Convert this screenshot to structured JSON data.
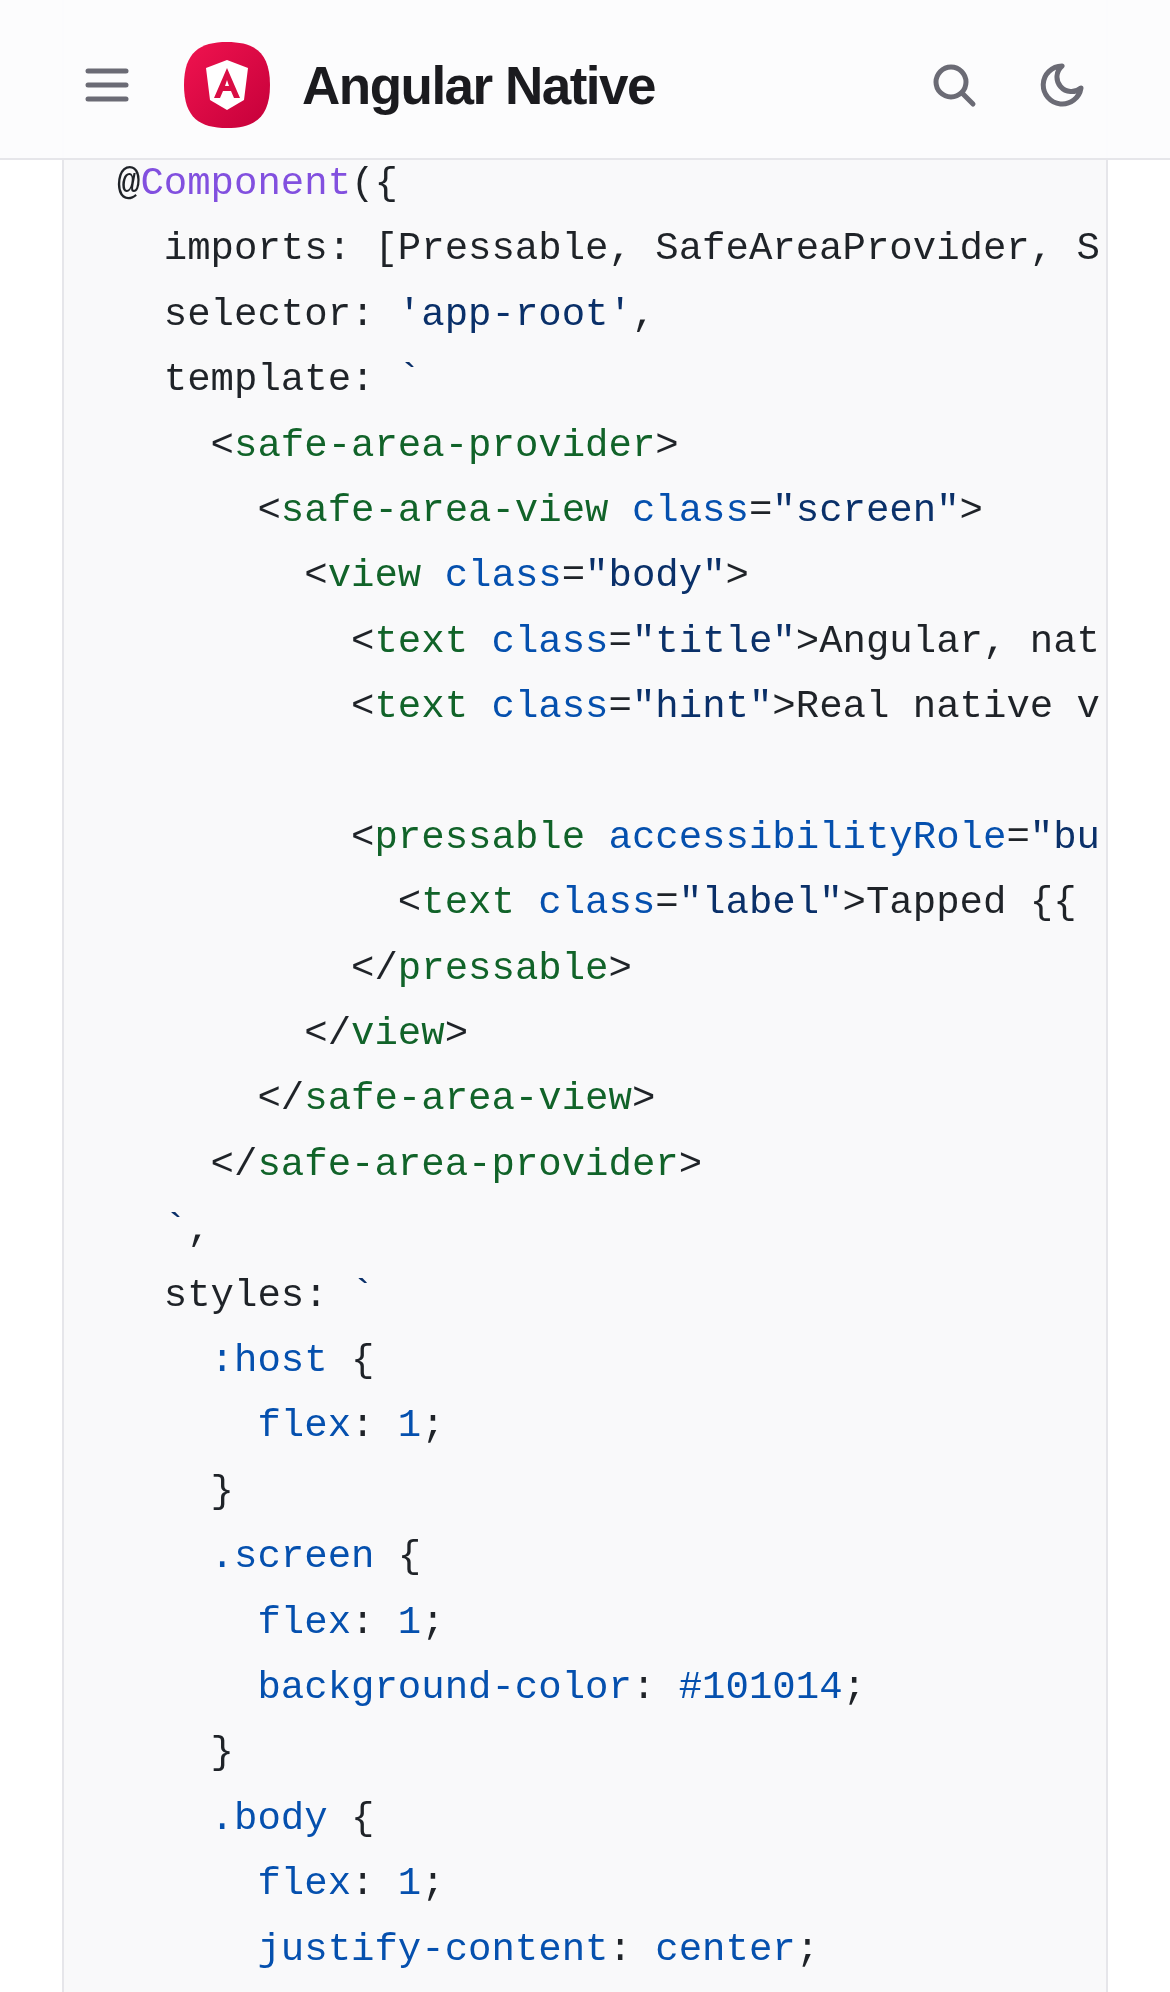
{
  "header": {
    "title": "Angular Native"
  },
  "code_block": {
    "lines": [
      {
        "kind": "code",
        "tokens": [
          {
            "kind": "plain",
            "text": "@"
          },
          {
            "kind": "decorator",
            "text": "Component"
          },
          {
            "kind": "plain",
            "text": "({"
          }
        ]
      },
      {
        "kind": "code",
        "tokens": [
          {
            "kind": "plain",
            "text": "  imports: [Pressable, SafeAreaProvider, S"
          }
        ]
      },
      {
        "kind": "code",
        "tokens": [
          {
            "kind": "plain",
            "text": "  selector: "
          },
          {
            "kind": "string",
            "text": "'app-root'"
          },
          {
            "kind": "plain",
            "text": ","
          }
        ]
      },
      {
        "kind": "code",
        "tokens": [
          {
            "kind": "plain",
            "text": "  template: "
          },
          {
            "kind": "string",
            "text": "`"
          }
        ]
      },
      {
        "kind": "code",
        "tokens": [
          {
            "kind": "plain",
            "text": "    <"
          },
          {
            "kind": "tag",
            "text": "safe-area-provider"
          },
          {
            "kind": "plain",
            "text": ">"
          }
        ]
      },
      {
        "kind": "code",
        "tokens": [
          {
            "kind": "plain",
            "text": "      <"
          },
          {
            "kind": "tag",
            "text": "safe-area-view"
          },
          {
            "kind": "attr",
            "text": " class"
          },
          {
            "kind": "plain",
            "text": "="
          },
          {
            "kind": "string",
            "text": "\"screen\""
          },
          {
            "kind": "plain",
            "text": ">"
          }
        ]
      },
      {
        "kind": "code",
        "tokens": [
          {
            "kind": "plain",
            "text": "        <"
          },
          {
            "kind": "tag",
            "text": "view"
          },
          {
            "kind": "attr",
            "text": " class"
          },
          {
            "kind": "plain",
            "text": "="
          },
          {
            "kind": "string",
            "text": "\"body\""
          },
          {
            "kind": "plain",
            "text": ">"
          }
        ]
      },
      {
        "kind": "code",
        "tokens": [
          {
            "kind": "plain",
            "text": "          <"
          },
          {
            "kind": "tag",
            "text": "text"
          },
          {
            "kind": "attr",
            "text": " class"
          },
          {
            "kind": "plain",
            "text": "="
          },
          {
            "kind": "string",
            "text": "\"title\""
          },
          {
            "kind": "plain",
            "text": ">Angular, nat"
          }
        ]
      },
      {
        "kind": "code",
        "tokens": [
          {
            "kind": "plain",
            "text": "          <"
          },
          {
            "kind": "tag",
            "text": "text"
          },
          {
            "kind": "attr",
            "text": " class"
          },
          {
            "kind": "plain",
            "text": "="
          },
          {
            "kind": "string",
            "text": "\"hint\""
          },
          {
            "kind": "plain",
            "text": ">Real native v"
          }
        ]
      },
      {
        "kind": "blank"
      },
      {
        "kind": "code",
        "tokens": [
          {
            "kind": "plain",
            "text": "          <"
          },
          {
            "kind": "tag",
            "text": "pressable"
          },
          {
            "kind": "attr",
            "text": " accessibilityRole"
          },
          {
            "kind": "plain",
            "text": "="
          },
          {
            "kind": "string",
            "text": "\"bu"
          }
        ]
      },
      {
        "kind": "code",
        "tokens": [
          {
            "kind": "plain",
            "text": "            <"
          },
          {
            "kind": "tag",
            "text": "text"
          },
          {
            "kind": "attr",
            "text": " class"
          },
          {
            "kind": "plain",
            "text": "="
          },
          {
            "kind": "string",
            "text": "\"label\""
          },
          {
            "kind": "plain",
            "text": ">Tapped {{"
          }
        ]
      },
      {
        "kind": "code",
        "tokens": [
          {
            "kind": "plain",
            "text": "          </"
          },
          {
            "kind": "tag",
            "text": "pressable"
          },
          {
            "kind": "plain",
            "text": ">"
          }
        ]
      },
      {
        "kind": "code",
        "tokens": [
          {
            "kind": "plain",
            "text": "        </"
          },
          {
            "kind": "tag",
            "text": "view"
          },
          {
            "kind": "plain",
            "text": ">"
          }
        ]
      },
      {
        "kind": "code",
        "tokens": [
          {
            "kind": "plain",
            "text": "      </"
          },
          {
            "kind": "tag",
            "text": "safe-area-view"
          },
          {
            "kind": "plain",
            "text": ">"
          }
        ]
      },
      {
        "kind": "code",
        "tokens": [
          {
            "kind": "plain",
            "text": "    </"
          },
          {
            "kind": "tag",
            "text": "safe-area-provider"
          },
          {
            "kind": "plain",
            "text": ">"
          }
        ]
      },
      {
        "kind": "code",
        "tokens": [
          {
            "kind": "string",
            "text": "  `"
          },
          {
            "kind": "plain",
            "text": ","
          }
        ]
      },
      {
        "kind": "code",
        "tokens": [
          {
            "kind": "plain",
            "text": "  styles: "
          },
          {
            "kind": "string",
            "text": "`"
          }
        ]
      },
      {
        "kind": "code",
        "tokens": [
          {
            "kind": "attr",
            "text": "    :host"
          },
          {
            "kind": "plain",
            "text": " {"
          }
        ]
      },
      {
        "kind": "code",
        "tokens": [
          {
            "kind": "attr",
            "text": "      flex"
          },
          {
            "kind": "plain",
            "text": ": "
          },
          {
            "kind": "attr",
            "text": "1"
          },
          {
            "kind": "plain",
            "text": ";"
          }
        ]
      },
      {
        "kind": "code",
        "tokens": [
          {
            "kind": "plain",
            "text": "    }"
          }
        ]
      },
      {
        "kind": "code",
        "tokens": [
          {
            "kind": "attr",
            "text": "    .screen"
          },
          {
            "kind": "plain",
            "text": " {"
          }
        ]
      },
      {
        "kind": "code",
        "tokens": [
          {
            "kind": "attr",
            "text": "      flex"
          },
          {
            "kind": "plain",
            "text": ": "
          },
          {
            "kind": "attr",
            "text": "1"
          },
          {
            "kind": "plain",
            "text": ";"
          }
        ]
      },
      {
        "kind": "code",
        "tokens": [
          {
            "kind": "attr",
            "text": "      background-color"
          },
          {
            "kind": "plain",
            "text": ": "
          },
          {
            "kind": "attr",
            "text": "#101014"
          },
          {
            "kind": "plain",
            "text": ";"
          }
        ]
      },
      {
        "kind": "code",
        "tokens": [
          {
            "kind": "plain",
            "text": "    }"
          }
        ]
      },
      {
        "kind": "code",
        "tokens": [
          {
            "kind": "attr",
            "text": "    .body"
          },
          {
            "kind": "plain",
            "text": " {"
          }
        ]
      },
      {
        "kind": "code",
        "tokens": [
          {
            "kind": "attr",
            "text": "      flex"
          },
          {
            "kind": "plain",
            "text": ": "
          },
          {
            "kind": "attr",
            "text": "1"
          },
          {
            "kind": "plain",
            "text": ";"
          }
        ]
      },
      {
        "kind": "code",
        "tokens": [
          {
            "kind": "attr",
            "text": "      justify-content"
          },
          {
            "kind": "plain",
            "text": ": "
          },
          {
            "kind": "attr",
            "text": "center"
          },
          {
            "kind": "plain",
            "text": ";"
          }
        ]
      }
    ]
  }
}
